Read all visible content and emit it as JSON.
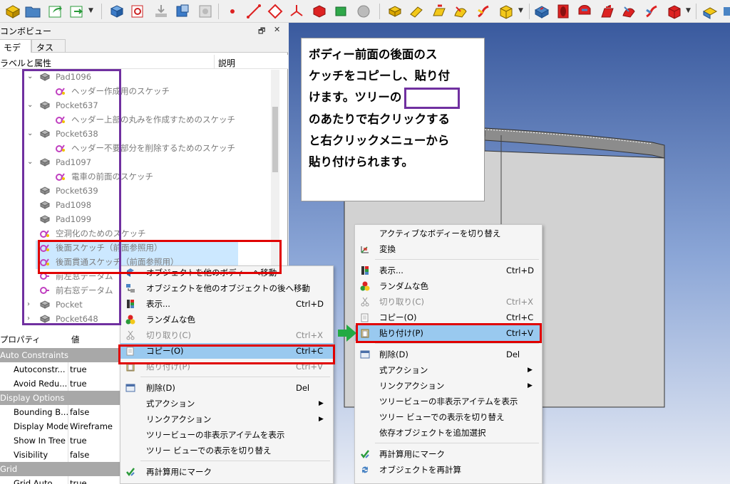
{
  "combo": {
    "title": "コンボビュー",
    "float_btn": "🗗",
    "close_btn": "✕"
  },
  "tabs": [
    {
      "label": "モデル"
    },
    {
      "label": "タスク"
    }
  ],
  "tree_header": {
    "label_col": "ラベルと属性",
    "desc_col": "説明"
  },
  "tree": [
    {
      "label": "Pad1096",
      "indent": 1,
      "expander": "v",
      "icon": "pad-icon"
    },
    {
      "label": "ヘッダー作成用のスケッチ",
      "indent": 2,
      "icon": "sketch-icon"
    },
    {
      "label": "Pocket637",
      "indent": 1,
      "expander": "v",
      "icon": "pocket-icon"
    },
    {
      "label": "ヘッダー上部の丸みを作成すためのスケッチ",
      "indent": 2,
      "icon": "sketch-icon"
    },
    {
      "label": "Pocket638",
      "indent": 1,
      "expander": "v",
      "icon": "pocket-icon"
    },
    {
      "label": "ヘッダー不要部分を削除するためのスケッチ",
      "indent": 2,
      "icon": "sketch-icon"
    },
    {
      "label": "Pad1097",
      "indent": 1,
      "expander": "v",
      "icon": "pad-icon"
    },
    {
      "label": "電車の前面のスケッチ",
      "indent": 2,
      "icon": "sketch-icon"
    },
    {
      "label": "Pocket639",
      "indent": 1,
      "expander": "",
      "icon": "pocket-icon"
    },
    {
      "label": "Pad1098",
      "indent": 1,
      "expander": "",
      "icon": "pad-icon"
    },
    {
      "label": "Pad1099",
      "indent": 1,
      "expander": "",
      "icon": "pad-icon"
    },
    {
      "label": "空洞化のためのスケッチ",
      "indent": 1,
      "expander": "",
      "icon": "sketch-icon"
    },
    {
      "label": "後面スケッチ（前面参照用）",
      "indent": 1,
      "expander": "",
      "icon": "sketch-icon",
      "selected": true
    },
    {
      "label": "後面貫通スケッチ（前面参照用）",
      "indent": 1,
      "expander": "",
      "icon": "sketch-icon",
      "selected": true
    },
    {
      "label": "前左窓データム",
      "indent": 1,
      "expander": "",
      "icon": "datum-icon"
    },
    {
      "label": "前右窓データム",
      "indent": 1,
      "expander": "",
      "icon": "datum-icon"
    },
    {
      "label": "Pocket",
      "indent": 1,
      "expander": ">",
      "icon": "pocket-icon"
    },
    {
      "label": "Pocket648",
      "indent": 1,
      "expander": ">",
      "icon": "pocket-icon"
    }
  ],
  "properties": {
    "header": {
      "name": "プロパティ",
      "value": "値"
    },
    "rows": [
      {
        "type": "cat",
        "name": "Auto Constraints"
      },
      {
        "type": "prop",
        "name": "Autoconstr...",
        "value": "true"
      },
      {
        "type": "prop",
        "name": "Avoid Redu...",
        "value": "true"
      },
      {
        "type": "cat",
        "name": "Display Options"
      },
      {
        "type": "prop",
        "name": "Bounding B...",
        "value": "false"
      },
      {
        "type": "prop",
        "name": "Display Mode",
        "value": "Wireframe"
      },
      {
        "type": "prop",
        "name": "Show In Tree",
        "value": "true"
      },
      {
        "type": "prop",
        "name": "Visibility",
        "value": "false"
      },
      {
        "type": "cat",
        "name": "Grid"
      },
      {
        "type": "prop",
        "name": "Grid Auto",
        "value": "true"
      }
    ]
  },
  "annotation": {
    "lines": [
      "ボディー前面の後面のス",
      "ケッチをコピーし、貼り付",
      "けます。ツリーの",
      "のあたりで右クリックする",
      "と右クリックメニューから",
      "貼り付けられます。"
    ]
  },
  "menu1": {
    "items": [
      {
        "label": "オブジェクトを他のボディーへ移動",
        "shortcut": "",
        "icon": "move-body-icon"
      },
      {
        "label": "オブジェクトを他のオブジェクトの後へ移動",
        "shortcut": "",
        "icon": "move-after-icon"
      },
      {
        "label": "表示...",
        "shortcut": "Ctrl+D",
        "icon": "appearance-icon"
      },
      {
        "label": "ランダムな色",
        "shortcut": "",
        "icon": "random-color-icon"
      },
      {
        "label": "切り取り(C)",
        "shortcut": "Ctrl+X",
        "icon": "cut-icon",
        "disabled": true
      },
      {
        "label": "コピー(O)",
        "shortcut": "Ctrl+C",
        "icon": "copy-icon",
        "highlight": true
      },
      {
        "label": "貼り付け(P)",
        "shortcut": "Ctrl+V",
        "icon": "paste-icon",
        "disabled": true
      },
      {
        "label": "削除(D)",
        "shortcut": "Del",
        "icon": "delete-icon"
      },
      {
        "label": "式アクション",
        "shortcut": "",
        "submenu": true
      },
      {
        "label": "リンクアクション",
        "shortcut": "",
        "submenu": true
      },
      {
        "label": "ツリービューの非表示アイテムを表示",
        "shortcut": ""
      },
      {
        "label": "ツリー ビューでの表示を切り替え",
        "shortcut": ""
      },
      {
        "label": "再計算用にマーク",
        "shortcut": "",
        "icon": "mark-recompute-icon"
      }
    ]
  },
  "menu2": {
    "items": [
      {
        "label": "アクティブなボディーを切り替え",
        "shortcut": ""
      },
      {
        "label": "変換",
        "shortcut": "",
        "icon": "transform-icon"
      },
      {
        "label": "表示...",
        "shortcut": "Ctrl+D",
        "icon": "appearance-icon"
      },
      {
        "label": "ランダムな色",
        "shortcut": "",
        "icon": "random-color-icon"
      },
      {
        "label": "切り取り(C)",
        "shortcut": "Ctrl+X",
        "icon": "cut-icon",
        "disabled": true
      },
      {
        "label": "コピー(O)",
        "shortcut": "Ctrl+C",
        "icon": "copy-icon"
      },
      {
        "label": "貼り付け(P)",
        "shortcut": "Ctrl+V",
        "icon": "paste-icon",
        "highlight": true
      },
      {
        "label": "削除(D)",
        "shortcut": "Del",
        "icon": "delete-icon"
      },
      {
        "label": "式アクション",
        "shortcut": "",
        "submenu": true
      },
      {
        "label": "リンクアクション",
        "shortcut": "",
        "submenu": true
      },
      {
        "label": "ツリービューの非表示アイテムを表示",
        "shortcut": ""
      },
      {
        "label": "ツリー ビューでの表示を切り替え",
        "shortcut": ""
      },
      {
        "label": "依存オブジェクトを追加選択",
        "shortcut": ""
      },
      {
        "label": "再計算用にマーク",
        "shortcut": "",
        "icon": "mark-recompute-icon"
      },
      {
        "label": "オブジェクトを再計算",
        "shortcut": "",
        "icon": "recompute-icon"
      }
    ]
  },
  "colors": {
    "purple": "#7030a0",
    "red": "#e00000",
    "green": "#22aa44",
    "highlight": "#99c9ef",
    "selection": "#cce8ff"
  }
}
